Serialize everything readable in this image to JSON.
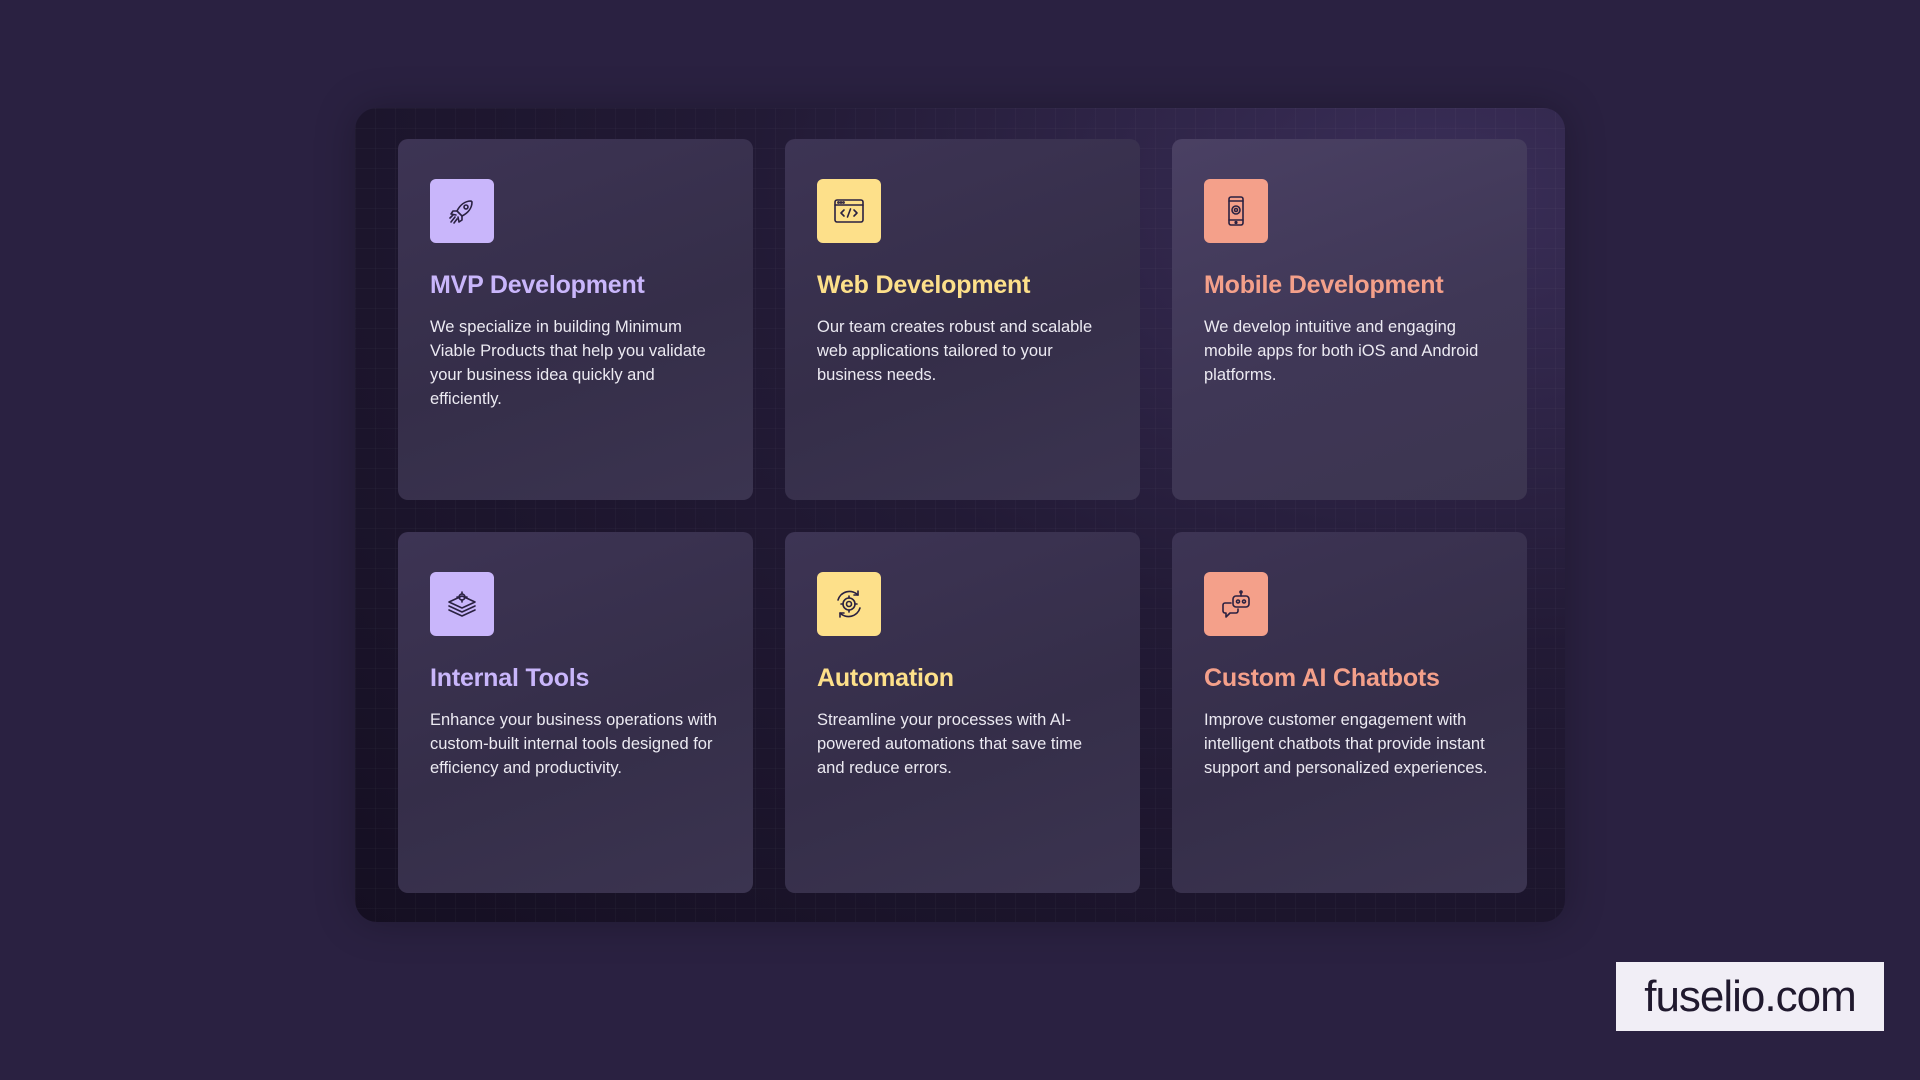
{
  "colors": {
    "background": "#2a2141",
    "purple": "#c9b6fb",
    "yellow": "#fde08a",
    "salmon": "#f4a08a",
    "icon_stroke": "#2a2141"
  },
  "cards": [
    {
      "icon": "rocket-icon",
      "title": "MVP Development",
      "description": "We specialize in building Minimum Viable Products that help you validate your business idea quickly and efficiently.",
      "accent": "#c9b6fb"
    },
    {
      "icon": "browser-code-icon",
      "title": "Web Development",
      "description": "Our team creates robust and scalable web applications tailored to your business needs.",
      "accent": "#fde08a"
    },
    {
      "icon": "mobile-phone-icon",
      "title": "Mobile Development",
      "description": "We develop intuitive and engaging mobile apps for both iOS and Android platforms.",
      "accent": "#f4a08a"
    },
    {
      "icon": "layers-gear-icon",
      "title": "Internal Tools",
      "description": "Enhance your business operations with custom-built internal tools designed for efficiency and productivity.",
      "accent": "#c9b6fb"
    },
    {
      "icon": "gear-cycle-icon",
      "title": "Automation",
      "description": "Streamline your processes with AI-powered automations that save time and reduce errors.",
      "accent": "#fde08a"
    },
    {
      "icon": "robot-chat-icon",
      "title": "Custom AI Chatbots",
      "description": "Improve customer engagement with intelligent chatbots that provide instant support and personalized experiences.",
      "accent": "#f4a08a"
    }
  ],
  "brand": {
    "label": "fuselio.com"
  }
}
